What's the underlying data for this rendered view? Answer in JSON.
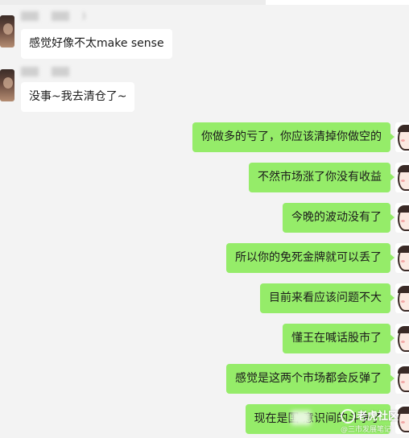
{
  "chat": {
    "incoming": [
      {
        "nickname_suffix": ")",
        "text": "感觉好像不太make sense"
      },
      {
        "nickname_suffix": "",
        "text": "没事~我去清仓了~"
      }
    ],
    "outgoing": [
      "你做多的亏了，你应该清掉你做空的",
      "不然市场涨了你没有收益",
      "今晚的波动没有了",
      "所以你的免死金牌就可以丢了",
      "目前来看应该问题不大",
      "懂王在喊话股市了",
      "感觉是这两个市场都会反弹了",
      "现在是国    意识间的斗争了"
    ]
  },
  "watermark": {
    "title": "老虎社区",
    "subtitle": "@三市发展笔记"
  },
  "colors": {
    "background": "#f3f3f3",
    "outgoing_bubble": "#95ec69",
    "incoming_bubble": "#ffffff",
    "text": "#1b1b1b"
  }
}
